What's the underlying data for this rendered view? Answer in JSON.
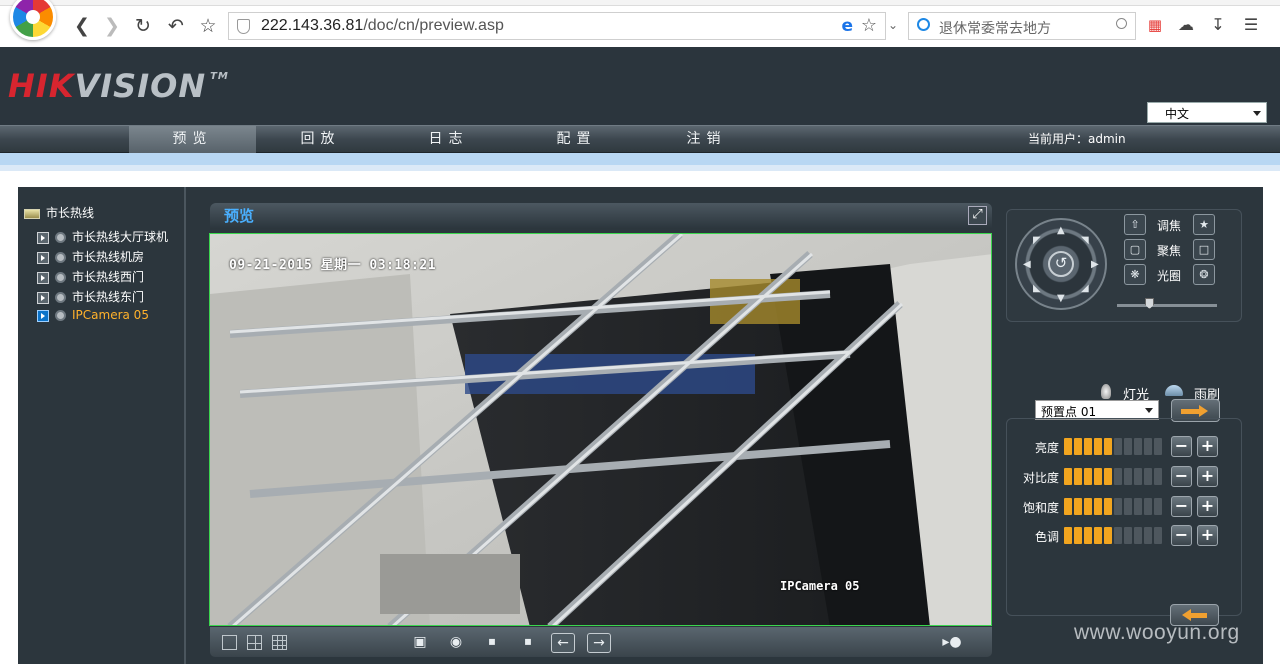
{
  "browser": {
    "url_host": "222.143.36.81",
    "url_path": "/doc/cn/preview.asp",
    "search_placeholder": "退休常委常去地方"
  },
  "header": {
    "logo_red": "HIK",
    "logo_grey": "VISION",
    "logo_tm": "TM",
    "language": "中文"
  },
  "nav": {
    "items": [
      "预览",
      "回放",
      "日志",
      "配置",
      "注销"
    ],
    "active": "预览",
    "current_user": "当前用户：admin"
  },
  "tree": {
    "root": "市长热线",
    "nodes": [
      "市长热线大厅球机",
      "市长热线机房",
      "市长热线西门",
      "市长热线东门",
      "IPCamera 05"
    ],
    "selected": "IPCamera 05"
  },
  "preview": {
    "title": "预览",
    "osd_time": "09-21-2015 星期一 03:18:21",
    "osd_camera": "IPCamera 05"
  },
  "ptz": {
    "zoom_label": "调焦",
    "focus_label": "聚焦",
    "iris_label": "光圈",
    "light_label": "灯光",
    "wiper_label": "雨刷",
    "preset_value": "预置点 01"
  },
  "image_settings": {
    "rows": [
      {
        "label": "亮度",
        "level": 5,
        "max": 10
      },
      {
        "label": "对比度",
        "level": 5,
        "max": 10
      },
      {
        "label": "饱和度",
        "level": 5,
        "max": 10
      },
      {
        "label": "色调",
        "level": 5,
        "max": 10
      }
    ]
  },
  "watermark": "www.wooyun.org",
  "colors": {
    "accent_blue": "#4ab0ff",
    "selected_node": "#ffb12b",
    "bar_on": "#f2a51f",
    "bar_off": "#4e575e",
    "video_border": "#3bd64e"
  }
}
